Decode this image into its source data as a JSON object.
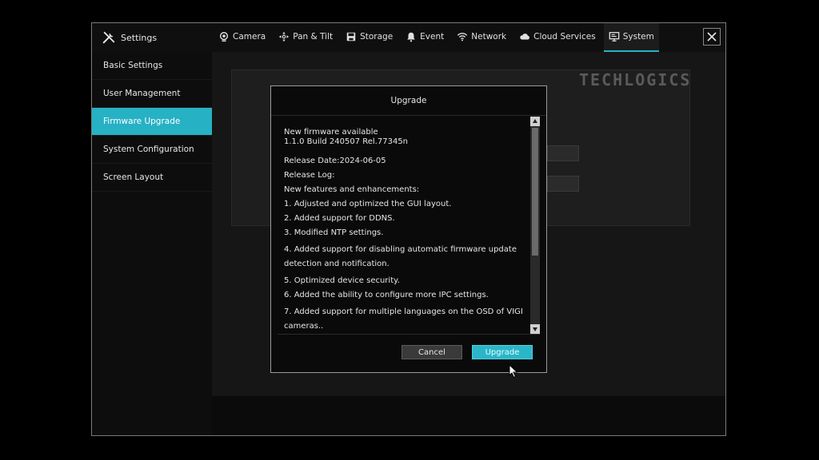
{
  "app": {
    "title": "Settings"
  },
  "tabs": [
    {
      "label": "Camera",
      "icon": "camera-icon"
    },
    {
      "label": "Pan & Tilt",
      "icon": "pan-tilt-icon"
    },
    {
      "label": "Storage",
      "icon": "storage-icon"
    },
    {
      "label": "Event",
      "icon": "bell-icon"
    },
    {
      "label": "Network",
      "icon": "wifi-icon"
    },
    {
      "label": "Cloud Services",
      "icon": "cloud-icon"
    },
    {
      "label": "System",
      "icon": "monitor-icon",
      "active": true
    }
  ],
  "sidebar": {
    "items": [
      {
        "label": "Basic Settings"
      },
      {
        "label": "User Management"
      },
      {
        "label": "Firmware Upgrade",
        "active": true
      },
      {
        "label": "System Configuration"
      },
      {
        "label": "Screen Layout"
      }
    ]
  },
  "watermark": "TECHLOGICS",
  "dialog": {
    "title": "Upgrade",
    "firmware_line1": "New firmware available",
    "firmware_line2": "1.1.0 Build 240507 Rel.77345n",
    "release_date": "Release Date:2024-06-05",
    "release_log": "Release Log:",
    "features_header": "New features and enhancements:",
    "items": [
      "1. Adjusted and optimized the GUI layout.",
      "2. Added support for DDNS.",
      "3. Modified NTP settings.",
      "4. Added support for disabling automatic firmware update detection and notification.",
      "5. Optimized device security.",
      "6. Added the ability to configure more IPC settings.",
      "7. Added support for multiple languages on the OSD of VIGI cameras.."
    ],
    "cancel_label": "Cancel",
    "upgrade_label": "Upgrade"
  },
  "colors": {
    "accent": "#27b1c4",
    "background": "#000000",
    "panel": "#0b0b0b"
  }
}
